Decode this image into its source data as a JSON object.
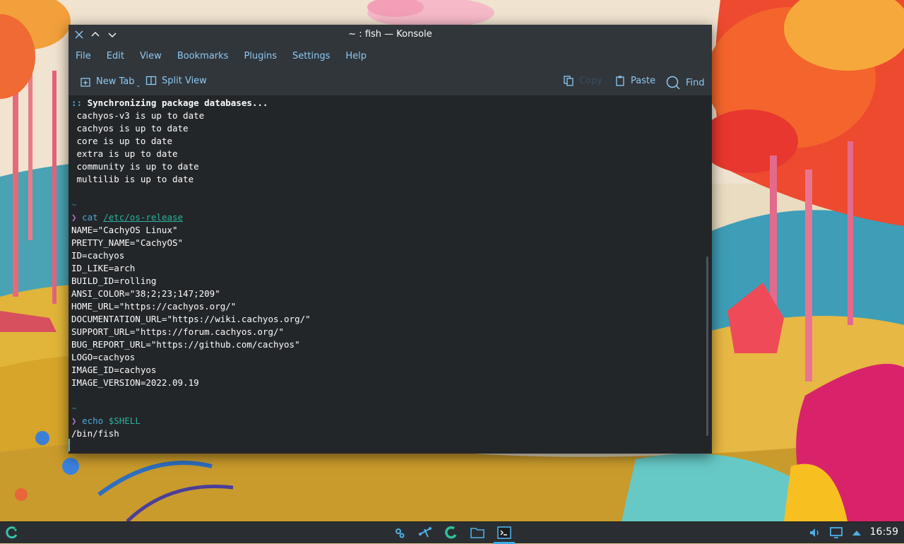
{
  "window": {
    "title": "~ : fish — Konsole",
    "controls": [
      "close-icon",
      "maximize-icon",
      "minimize-icon"
    ]
  },
  "menubar": {
    "items": [
      "File",
      "Edit",
      "View",
      "Bookmarks",
      "Plugins",
      "Settings",
      "Help"
    ]
  },
  "toolbar": {
    "new_tab": "New Tab",
    "split_view": "Split View",
    "copy": "Copy",
    "paste": "Paste",
    "find": "Find"
  },
  "terminal": {
    "sync_prefix": "::",
    "sync_text": " Synchronizing package databases...",
    "sync_lines": [
      " cachyos-v3 is up to date",
      " cachyos is up to date",
      " core is up to date",
      " extra is up to date",
      " community is up to date",
      " multilib is up to date"
    ],
    "tilde": "~",
    "prompt_symbol": "❯",
    "cmd1": "cat",
    "cmd1_arg": "/etc/os-release",
    "os_release": [
      "NAME=\"CachyOS Linux\"",
      "PRETTY_NAME=\"CachyOS\"",
      "ID=cachyos",
      "ID_LIKE=arch",
      "BUILD_ID=rolling",
      "ANSI_COLOR=\"38;2;23;147;209\"",
      "HOME_URL=\"https://cachyos.org/\"",
      "DOCUMENTATION_URL=\"https://wiki.cachyos.org/\"",
      "SUPPORT_URL=\"https://forum.cachyos.org/\"",
      "BUG_REPORT_URL=\"https://github.com/cachyos\"",
      "LOGO=cachyos",
      "IMAGE_ID=cachyos",
      "IMAGE_VERSION=2022.09.19"
    ],
    "cmd2": "echo",
    "cmd2_arg": "$SHELL",
    "shell_output": "/bin/fish"
  },
  "panel": {
    "launcher_icon": "cachyos-launcher-icon",
    "tasks": [
      "settings-icon",
      "kdeconnect-icon",
      "cachyos-hello-icon",
      "file-manager-icon",
      "konsole-icon"
    ],
    "tray": [
      "volume-icon",
      "display-icon",
      "tray-expand-icon"
    ],
    "clock": "16:59"
  },
  "colors": {
    "accent": "#3daee9",
    "window_bg": "#232629",
    "chrome_bg": "#31363b",
    "menu_text": "#8ec9f2"
  }
}
